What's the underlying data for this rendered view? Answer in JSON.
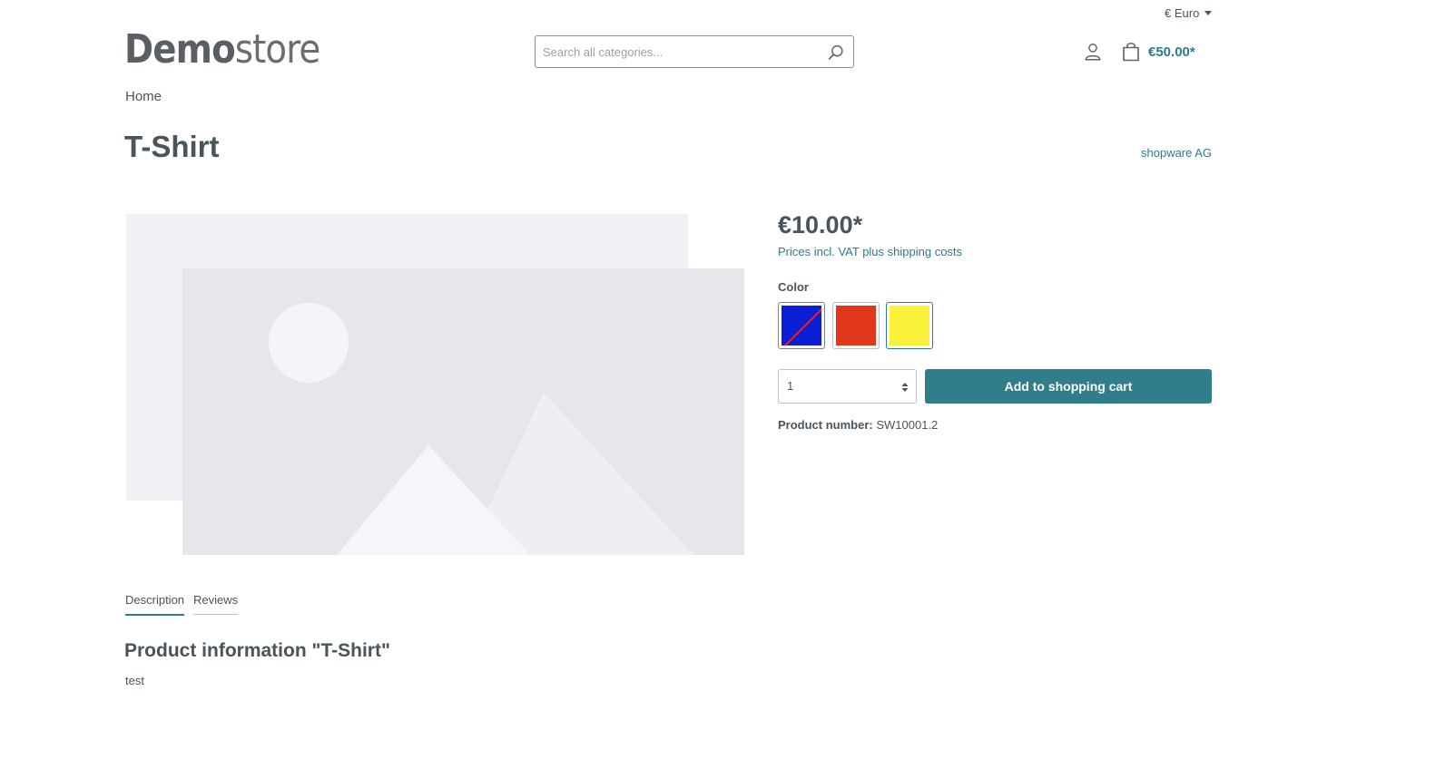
{
  "header": {
    "currency": "€ Euro",
    "logo": {
      "bold": "Demo",
      "light": "store"
    },
    "search": {
      "placeholder": "Search all categories...",
      "value": ""
    },
    "cart_total": "€50.00*"
  },
  "breadcrumb": {
    "home": "Home"
  },
  "product": {
    "title": "T-Shirt",
    "manufacturer": "shopware AG",
    "price": "€10.00*",
    "tax_note": "Prices incl. VAT plus shipping costs",
    "color_label": "Color",
    "colors": [
      {
        "name": "blue",
        "hex": "#0a1ed6",
        "unavailable": true
      },
      {
        "name": "red",
        "hex": "#e0371d",
        "unavailable": false
      },
      {
        "name": "yellow",
        "hex": "#fbf13b",
        "selected": true
      }
    ],
    "quantity": "1",
    "add_to_cart": "Add to shopping cart",
    "number_label": "Product number:",
    "number_value": "SW10001.2"
  },
  "tabs": [
    {
      "label": "Description",
      "active": true
    },
    {
      "label": "Reviews",
      "active": false
    }
  ],
  "description": {
    "title": "Product information \"T-Shirt\"",
    "body": "test"
  },
  "colors": {
    "accent": "#2b7d89",
    "text": "#4a545b",
    "placeholder_bg": "#f0f1f4",
    "placeholder_fg": "#e6e7eb"
  },
  "icons": {
    "search": "search-icon",
    "account": "user-icon",
    "cart": "shopping-bag-icon",
    "currency_caret": "caret-down-icon",
    "quantity_arrows": "select-arrows-icon",
    "image_placeholder": "image-placeholder-icon"
  }
}
